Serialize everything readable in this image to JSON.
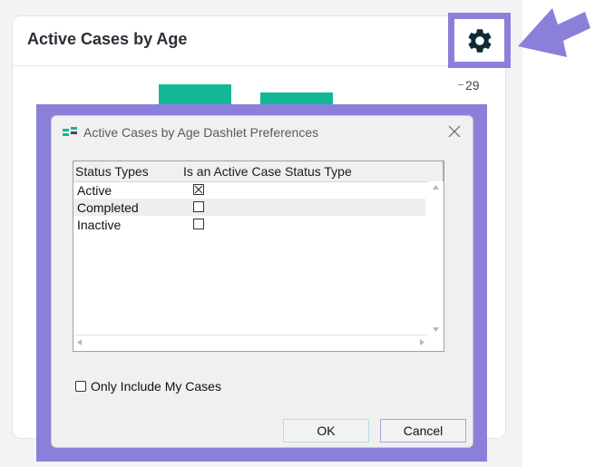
{
  "dashlet": {
    "title": "Active Cases by Age",
    "axis_tick": "29",
    "bar_color": "#12b896"
  },
  "settings_icon": "gear-icon",
  "highlight_color": "#8b80d9",
  "dialog": {
    "title": "Active Cases by Age Dashlet Preferences",
    "columns": [
      "Status Types",
      "Is an Active Case Status Type"
    ],
    "rows": [
      {
        "label": "Active",
        "checked": true
      },
      {
        "label": "Completed",
        "checked": false
      },
      {
        "label": "Inactive",
        "checked": false
      }
    ],
    "only_mine_label": "Only Include My Cases",
    "only_mine_checked": false,
    "ok_label": "OK",
    "cancel_label": "Cancel"
  }
}
